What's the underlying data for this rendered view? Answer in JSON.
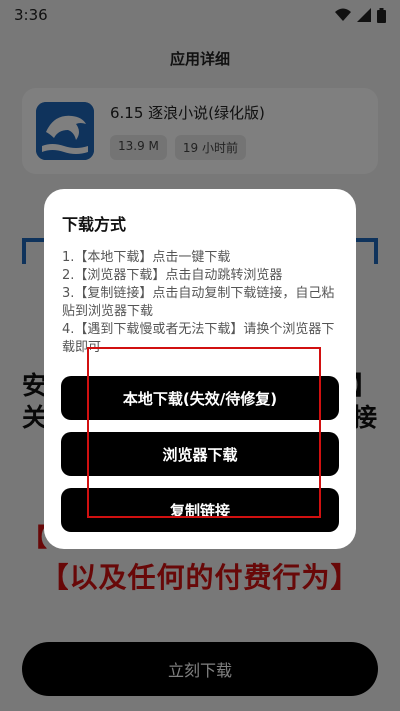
{
  "status": {
    "time": "3:36"
  },
  "page": {
    "title": "应用详细"
  },
  "app": {
    "name": "6.15 逐浪小说(绿化版)",
    "size": "13.9 M",
    "updated": "19 小时前"
  },
  "notice": {
    "lines": [
      "安",
      "关",
      "",
      "",
      "【",
      "【以及任何的付费行为】"
    ],
    "right_fragments": [
      "】",
      "接"
    ]
  },
  "download_now": "立刻下载",
  "dialog": {
    "title": "下载方式",
    "lines": [
      "1.【本地下载】点击一键下载",
      "2.【浏览器下载】点击自动跳转浏览器",
      "3.【复制链接】点击自动复制下载链接，自己粘贴到浏览器下载",
      "4.【遇到下载慢或者无法下载】请换个浏览器下载即可"
    ],
    "buttons": [
      "本地下载(失效/待修复)",
      "浏览器下载",
      "复制链接"
    ]
  },
  "colors": {
    "accent_blue": "#1f67b9",
    "warning_red": "#d11010",
    "green": "#2a8a2a"
  }
}
